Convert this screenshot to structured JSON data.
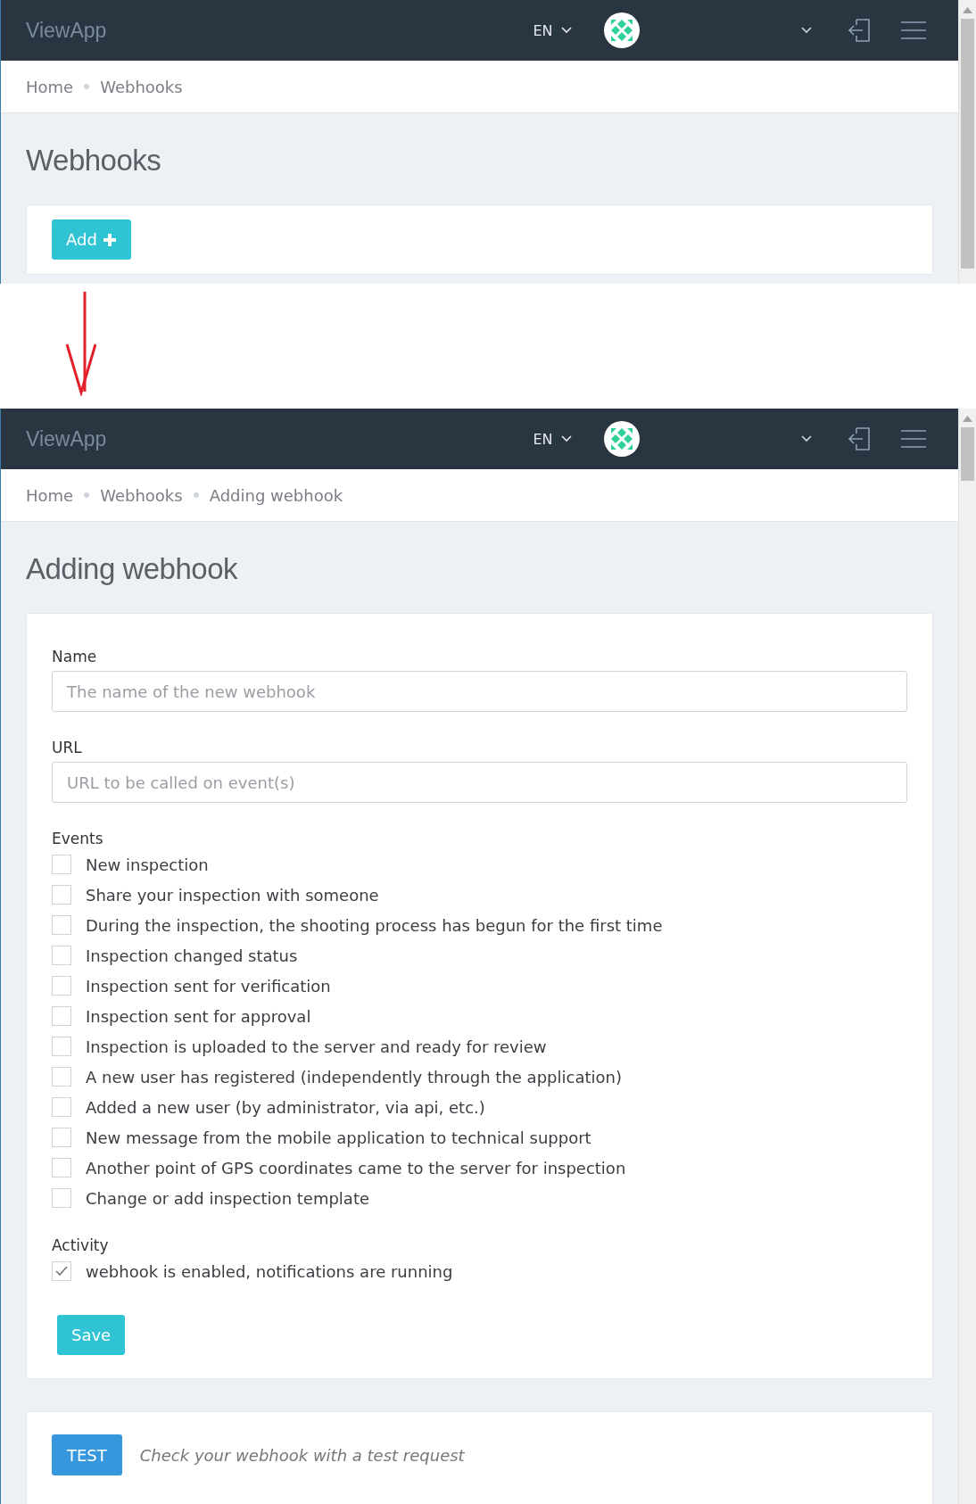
{
  "before": {
    "navbar": {
      "brand": "ViewApp",
      "language": "EN"
    },
    "breadcrumb": [
      {
        "label": "Home"
      },
      {
        "label": "Webhooks"
      }
    ],
    "title": "Webhooks",
    "add_button": "Add"
  },
  "after": {
    "navbar": {
      "brand": "ViewApp",
      "language": "EN"
    },
    "breadcrumb": [
      {
        "label": "Home"
      },
      {
        "label": "Webhooks"
      },
      {
        "label": "Adding webhook"
      }
    ],
    "title": "Adding webhook",
    "form": {
      "name": {
        "label": "Name",
        "placeholder": "The name of the new webhook"
      },
      "url": {
        "label": "URL",
        "placeholder": "URL to be called on event(s)"
      },
      "events_label": "Events",
      "events": [
        {
          "label": "New inspection",
          "checked": false
        },
        {
          "label": "Share your inspection with someone",
          "checked": false
        },
        {
          "label": "During the inspection, the shooting process has begun for the first time",
          "checked": false
        },
        {
          "label": "Inspection changed status",
          "checked": false
        },
        {
          "label": "Inspection sent for verification",
          "checked": false
        },
        {
          "label": "Inspection sent for approval",
          "checked": false
        },
        {
          "label": "Inspection is uploaded to the server and ready for review",
          "checked": false
        },
        {
          "label": "A new user has registered (independently through the application)",
          "checked": false
        },
        {
          "label": "Added a new user (by administrator, via api, etc.)",
          "checked": false
        },
        {
          "label": "New message from the mobile application to technical support",
          "checked": false
        },
        {
          "label": "Another point of GPS coordinates came to the server for inspection",
          "checked": false
        },
        {
          "label": "Change or add inspection template",
          "checked": false
        }
      ],
      "activity_label": "Activity",
      "activity": {
        "label": "webhook is enabled, notifications are running",
        "checked": true
      },
      "save_button": "Save"
    },
    "test": {
      "button": "TEST",
      "hint": "Check your webhook with a test request"
    }
  }
}
